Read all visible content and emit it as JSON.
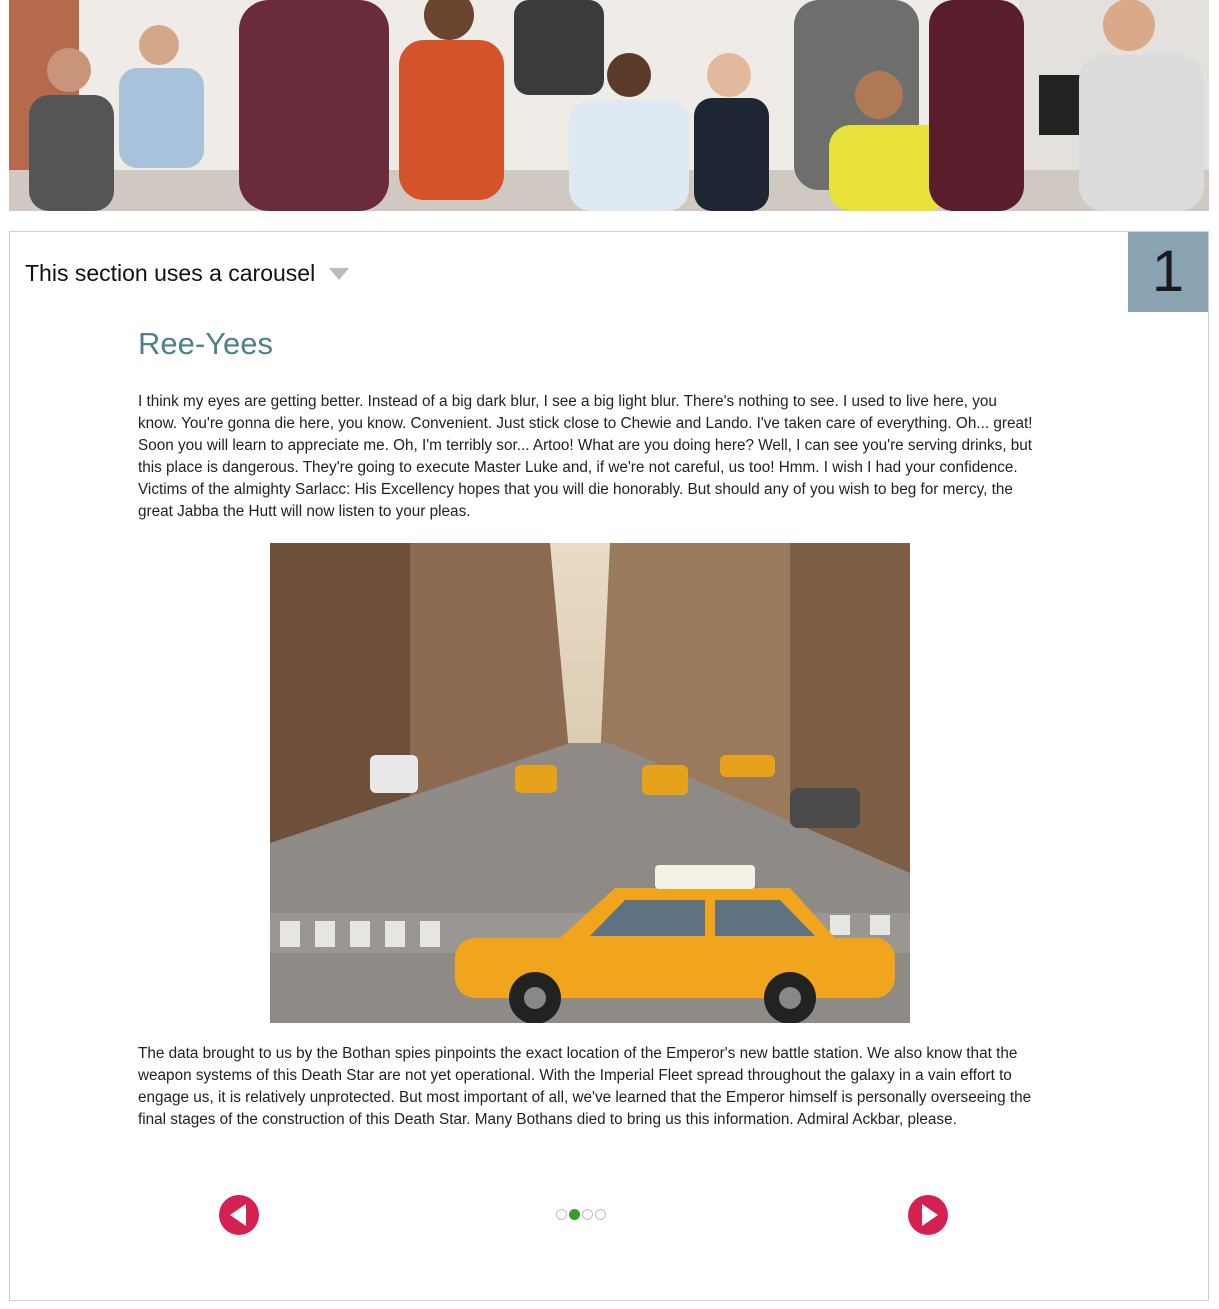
{
  "banner": {
    "icon": "team-photo"
  },
  "section": {
    "title": "This section uses a carousel",
    "number": "1",
    "toggle_icon": "caret-down-icon",
    "number_badge_color": "#8aa3b3"
  },
  "slide": {
    "title": "Ree-Yees",
    "title_color": "#4e8289",
    "paragraph1": "I think my eyes are getting better. Instead of a big dark blur, I see a big light blur. There's nothing to see. I used to live here, you know. You're gonna die here, you know. Convenient. Just stick close to Chewie and Lando. I've taken care of everything. Oh... great! Soon you will learn to appreciate me. Oh, I'm terribly sor... Artoo! What are you doing here? Well, I can see you're serving drinks, but this place is dangerous. They're going to execute Master Luke and, if we're not careful, us too! Hmm. I wish I had your confidence. Victims of the almighty Sarlacc: His Excellency hopes that you will die honorably. But should any of you wish to beg for mercy, the great Jabba the Hutt will now listen to your pleas.",
    "image": "city-street-taxi-photo",
    "paragraph2": "The data brought to us by the Bothan spies pinpoints the exact location of the Emperor's new battle station. We also know that the weapon systems of this Death Star are not yet operational. With the Imperial Fleet spread throughout the galaxy in a vain effort to engage us, it is relatively unprotected. But most important of all, we've learned that the Emperor himself is personally overseeing the final stages of the construction of this Death Star. Many Bothans died to bring us this information. Admiral Ackbar, please."
  },
  "carousel": {
    "prev_icon": "arrow-left-icon",
    "next_icon": "arrow-right-icon",
    "button_color": "#d6204f",
    "active_dot_color": "#3a9a2e",
    "total_slides": 4,
    "active_slide": 2
  }
}
